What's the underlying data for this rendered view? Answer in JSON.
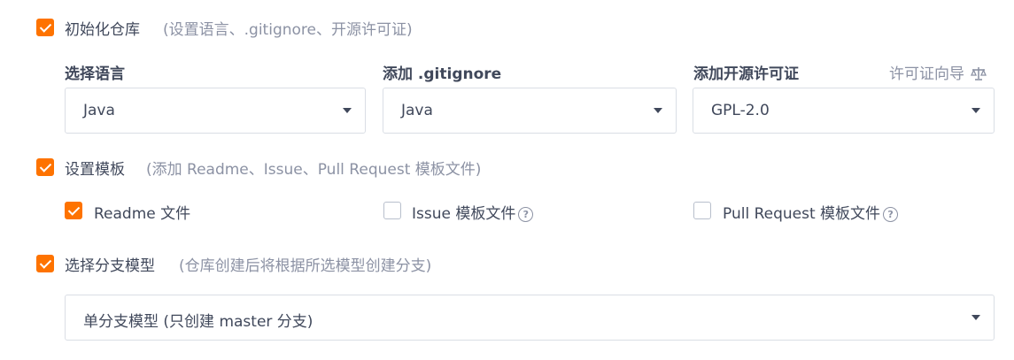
{
  "init_repo": {
    "label": "初始化仓库",
    "hint": "(设置语言、.gitignore、开源许可证)",
    "checked": true,
    "language": {
      "label": "选择语言",
      "value": "Java"
    },
    "gitignore": {
      "label": "添加 .gitignore",
      "value": "Java"
    },
    "license": {
      "label": "添加开源许可证",
      "value": "GPL-2.0",
      "wizard_link": "许可证向导",
      "wizard_icon": "scale-icon"
    }
  },
  "templates": {
    "label": "设置模板",
    "hint": "(添加 Readme、Issue、Pull Request 模板文件)",
    "checked": true,
    "options": [
      {
        "label": "Readme 文件",
        "checked": true,
        "help": false
      },
      {
        "label": "Issue 模板文件",
        "checked": false,
        "help": true
      },
      {
        "label": "Pull Request 模板文件",
        "checked": false,
        "help": true
      }
    ]
  },
  "branch_model": {
    "label": "选择分支模型",
    "hint": "(仓库创建后将根据所选模型创建分支)",
    "checked": true,
    "value": "单分支模型 (只创建 master 分支)"
  },
  "colors": {
    "accent": "#fe7300",
    "text": "#40485b",
    "muted": "#8c92a4",
    "border": "#dadee5"
  },
  "icons": {
    "help": "question-circle-icon",
    "dropdown": "caret-down-icon"
  }
}
